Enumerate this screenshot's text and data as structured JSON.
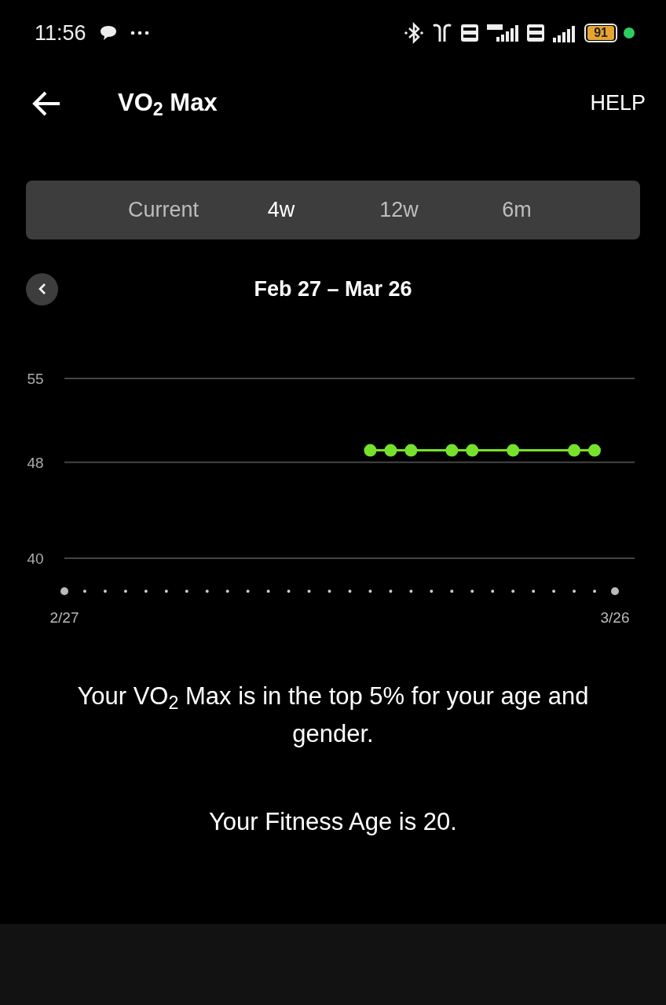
{
  "status_bar": {
    "time": "11:56",
    "battery": "91"
  },
  "header": {
    "title": "VO$_{2}$ Max",
    "help": "HELP"
  },
  "tabs": [
    {
      "label": "Current",
      "selected": false
    },
    {
      "label": "4w",
      "selected": true
    },
    {
      "label": "12w",
      "selected": false
    },
    {
      "label": "6m",
      "selected": false
    }
  ],
  "date_range": "Feb 27 – Mar 26",
  "chart_data": {
    "type": "line",
    "categories": [
      "2/27",
      null,
      null,
      null,
      null,
      null,
      null,
      null,
      null,
      null,
      null,
      null,
      null,
      null,
      null,
      null,
      null,
      null,
      null,
      null,
      null,
      null,
      null,
      null,
      null,
      null,
      null,
      "3/26"
    ],
    "series": [
      {
        "color": "#76e22b",
        "marker": true,
        "values": [
          null,
          null,
          null,
          null,
          null,
          null,
          null,
          null,
          null,
          null,
          null,
          null,
          null,
          null,
          null,
          49,
          49,
          49,
          null,
          49,
          49,
          null,
          49,
          null,
          null,
          49,
          49,
          null
        ]
      }
    ],
    "ylim": [
      40,
      55
    ],
    "yticks": [
      40,
      48,
      55
    ]
  },
  "summary": "Your VO$_{2}$ Max is in the top 5% for your age and gender.",
  "fitness_age": "Your Fitness Age is 20."
}
